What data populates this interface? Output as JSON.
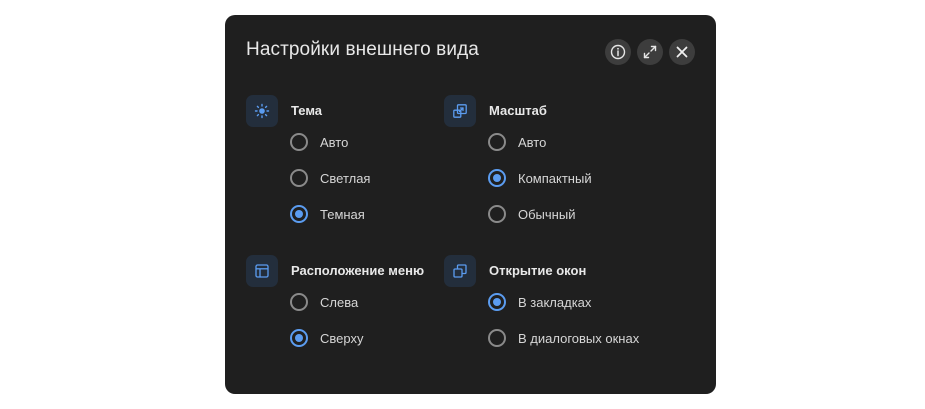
{
  "dialog": {
    "title": "Настройки внешнего вида",
    "buttons": {
      "info_icon": "info-icon",
      "expand_icon": "expand-icon",
      "close_icon": "close-icon"
    }
  },
  "colors": {
    "background": "#1f1f1f",
    "accent": "#5b9cf0",
    "icon_tile": "#232e3c",
    "header_button": "#3d3d3d"
  },
  "sections": {
    "theme": {
      "title": "Тема",
      "icon": "sun-icon",
      "options": [
        {
          "label": "Авто",
          "checked": false
        },
        {
          "label": "Светлая",
          "checked": false
        },
        {
          "label": "Темная",
          "checked": true
        }
      ]
    },
    "scale": {
      "title": "Масштаб",
      "icon": "scale-icon",
      "options": [
        {
          "label": "Авто",
          "checked": false
        },
        {
          "label": "Компактный",
          "checked": true
        },
        {
          "label": "Обычный",
          "checked": false
        }
      ]
    },
    "menu": {
      "title": "Расположение меню",
      "icon": "layout-icon",
      "options": [
        {
          "label": "Слева",
          "checked": false
        },
        {
          "label": "Сверху",
          "checked": true
        }
      ]
    },
    "windows": {
      "title": "Открытие окон",
      "icon": "windows-icon",
      "options": [
        {
          "label": "В закладках",
          "checked": true
        },
        {
          "label": "В диалоговых окнах",
          "checked": false
        }
      ]
    }
  }
}
